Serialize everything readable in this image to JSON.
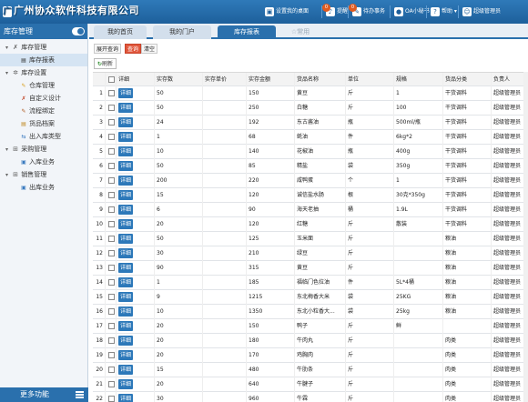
{
  "app": {
    "logo_text": "广州协众软件科技有限公司"
  },
  "topnav": [
    {
      "label": "设置我的桌面",
      "icon": "desktop-icon",
      "badge": ""
    },
    {
      "label": "提醒",
      "icon": "bell-icon",
      "badge": "0"
    },
    {
      "label": "待办事务",
      "icon": "todo-icon",
      "badge": "0"
    },
    {
      "label": "OA小秘书",
      "icon": "secretary-icon",
      "badge": ""
    },
    {
      "label": "帮助",
      "icon": "help-icon",
      "badge": ""
    },
    {
      "label": "超级管理员",
      "icon": "user-icon",
      "badge": ""
    }
  ],
  "sidebar": {
    "title": "库存管理",
    "groups": [
      {
        "label": "库存管理",
        "icon": "wrench-icon",
        "items": [
          "库存报表"
        ]
      },
      {
        "label": "库存设置",
        "icon": "gear-icon",
        "items": [
          "仓库管理",
          "自定义设计",
          "流程绑定",
          "货品档案",
          "出入库类型"
        ]
      },
      {
        "label": "采购管理",
        "icon": "cart-icon",
        "items": [
          "入库业务"
        ]
      },
      {
        "label": "销售管理",
        "icon": "sale-icon",
        "items": [
          "出库业务"
        ]
      }
    ],
    "footer": "更多功能"
  },
  "tabs": [
    "我的首页",
    "我的门户",
    "库存报表",
    "常用"
  ],
  "toolbar": {
    "expand": "展开查询",
    "query": "查询",
    "clear": "清空",
    "refresh": "刷新"
  },
  "table": {
    "columns": [
      "",
      "",
      "详细",
      "实存数",
      "实存单价",
      "实存金额",
      "货品名称",
      "单位",
      "规格",
      "货品分类",
      "负责人"
    ],
    "rows": [
      {
        "n": "1",
        "qty": "50",
        "price": "",
        "amt": "150",
        "name": "黄豆",
        "unit": "斤",
        "spec": "1",
        "cat": "干货调料",
        "owner": "超级管理员"
      },
      {
        "n": "2",
        "qty": "50",
        "price": "",
        "amt": "250",
        "name": "白糖",
        "unit": "斤",
        "spec": "100",
        "cat": "干货调料",
        "owner": "超级管理员"
      },
      {
        "n": "3",
        "qty": "24",
        "price": "",
        "amt": "192",
        "name": "东古酱油",
        "unit": "瓶",
        "spec": "500ml/瓶",
        "cat": "干货调料",
        "owner": "超级管理员"
      },
      {
        "n": "4",
        "qty": "1",
        "price": "",
        "amt": "68",
        "name": "蚝油",
        "unit": "件",
        "spec": "6kg*2",
        "cat": "干货调料",
        "owner": "超级管理员"
      },
      {
        "n": "5",
        "qty": "10",
        "price": "",
        "amt": "140",
        "name": "花椒油",
        "unit": "瓶",
        "spec": "400g",
        "cat": "干货调料",
        "owner": "超级管理员"
      },
      {
        "n": "6",
        "qty": "50",
        "price": "",
        "amt": "85",
        "name": "精盐",
        "unit": "袋",
        "spec": "350g",
        "cat": "干货调料",
        "owner": "超级管理员"
      },
      {
        "n": "7",
        "qty": "200",
        "price": "",
        "amt": "220",
        "name": "咸鸭蛋",
        "unit": "个",
        "spec": "1",
        "cat": "干货调料",
        "owner": "超级管理员"
      },
      {
        "n": "8",
        "qty": "15",
        "price": "",
        "amt": "120",
        "name": "诚信盐水肠",
        "unit": "根",
        "spec": "30克*350g",
        "cat": "干货调料",
        "owner": "超级管理员"
      },
      {
        "n": "9",
        "qty": "6",
        "price": "",
        "amt": "90",
        "name": "海天老抽",
        "unit": "桶",
        "spec": "1.9L",
        "cat": "干货调料",
        "owner": "超级管理员"
      },
      {
        "n": "10",
        "qty": "20",
        "price": "",
        "amt": "120",
        "name": "红糖",
        "unit": "斤",
        "spec": "散装",
        "cat": "干货调料",
        "owner": "超级管理员"
      },
      {
        "n": "11",
        "qty": "50",
        "price": "",
        "amt": "125",
        "name": "玉米面",
        "unit": "斤",
        "spec": "",
        "cat": "粮油",
        "owner": "超级管理员"
      },
      {
        "n": "12",
        "qty": "30",
        "price": "",
        "amt": "210",
        "name": "绿豆",
        "unit": "斤",
        "spec": "",
        "cat": "粮油",
        "owner": "超级管理员"
      },
      {
        "n": "13",
        "qty": "90",
        "price": "",
        "amt": "315",
        "name": "黄豆",
        "unit": "斤",
        "spec": "",
        "cat": "粮油",
        "owner": "超级管理员"
      },
      {
        "n": "14",
        "qty": "1",
        "price": "",
        "amt": "185",
        "name": "福临门色拉油",
        "unit": "件",
        "spec": "5L*4桶",
        "cat": "粮油",
        "owner": "超级管理员"
      },
      {
        "n": "15",
        "qty": "9",
        "price": "",
        "amt": "1215",
        "name": "东北梅香大米",
        "unit": "袋",
        "spec": "25KG",
        "cat": "粮油",
        "owner": "超级管理员"
      },
      {
        "n": "16",
        "qty": "10",
        "price": "",
        "amt": "1350",
        "name": "东北小粒香大...",
        "unit": "袋",
        "spec": "25kg",
        "cat": "粮油",
        "owner": "超级管理员"
      },
      {
        "n": "17",
        "qty": "20",
        "price": "",
        "amt": "150",
        "name": "鸭子",
        "unit": "斤",
        "spec": "鲜",
        "cat": "",
        "owner": "超级管理员"
      },
      {
        "n": "18",
        "qty": "20",
        "price": "",
        "amt": "180",
        "name": "牛肉丸",
        "unit": "斤",
        "spec": "",
        "cat": "肉类",
        "owner": "超级管理员"
      },
      {
        "n": "19",
        "qty": "20",
        "price": "",
        "amt": "170",
        "name": "鸡胸肉",
        "unit": "斤",
        "spec": "",
        "cat": "肉类",
        "owner": "超级管理员"
      },
      {
        "n": "20",
        "qty": "15",
        "price": "",
        "amt": "480",
        "name": "牛肋条",
        "unit": "斤",
        "spec": "",
        "cat": "肉类",
        "owner": "超级管理员"
      },
      {
        "n": "21",
        "qty": "20",
        "price": "",
        "amt": "640",
        "name": "牛腱子",
        "unit": "斤",
        "spec": "",
        "cat": "肉类",
        "owner": "超级管理员"
      },
      {
        "n": "22",
        "qty": "30",
        "price": "",
        "amt": "960",
        "name": "牛霖",
        "unit": "斤",
        "spec": "",
        "cat": "肉类",
        "owner": "超级管理员"
      },
      {
        "n": "23",
        "qty": "20",
        "price": "",
        "amt": "640",
        "name": "牛肉",
        "unit": "斤",
        "spec": "",
        "cat": "肉类",
        "owner": "超级管理员"
      }
    ],
    "detail_label": "详细"
  },
  "colors": {
    "primary": "#2a70ad",
    "detail_btn": "#2c78b9",
    "query_btn": "#e0563b"
  }
}
